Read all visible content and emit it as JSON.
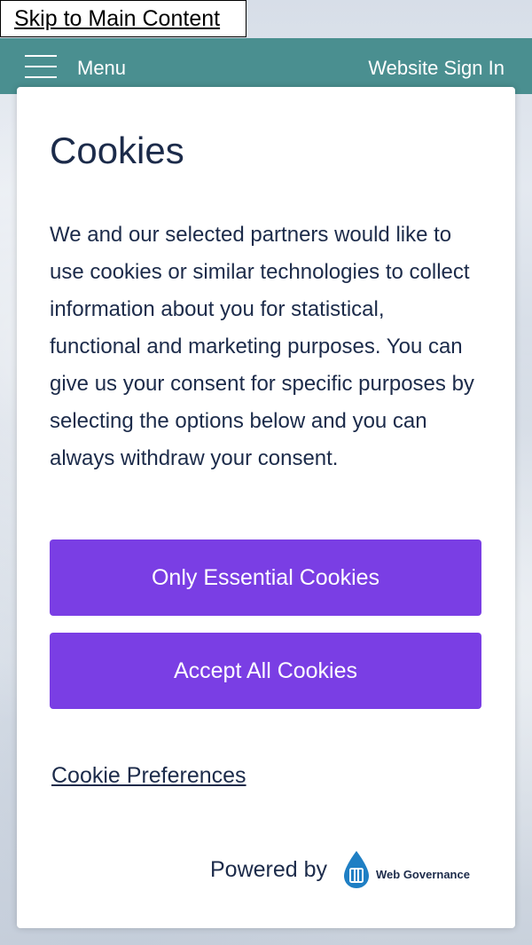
{
  "skip_link": {
    "label": "Skip to Main Content"
  },
  "topbar": {
    "menu_icon": "hamburger-icon",
    "menu_label": "Menu",
    "signin_label": "Website Sign In",
    "color": "#4a8f90"
  },
  "cookie_modal": {
    "title": "Cookies",
    "body": "We and our selected partners would like to use cookies or similar technologies to collect information about you for statistical, functional and marketing purposes. You can give us your consent for specific purposes by selecting the options below and you can always withdraw your consent.",
    "essential_button": "Only Essential Cookies",
    "accept_button": "Accept All Cookies",
    "button_color": "#7a3ee4",
    "preferences_link": "Cookie Preferences",
    "powered_by": "Powered by",
    "vendor_icon": "water-drop-logo-icon",
    "vendor_name": "Web Governance"
  }
}
